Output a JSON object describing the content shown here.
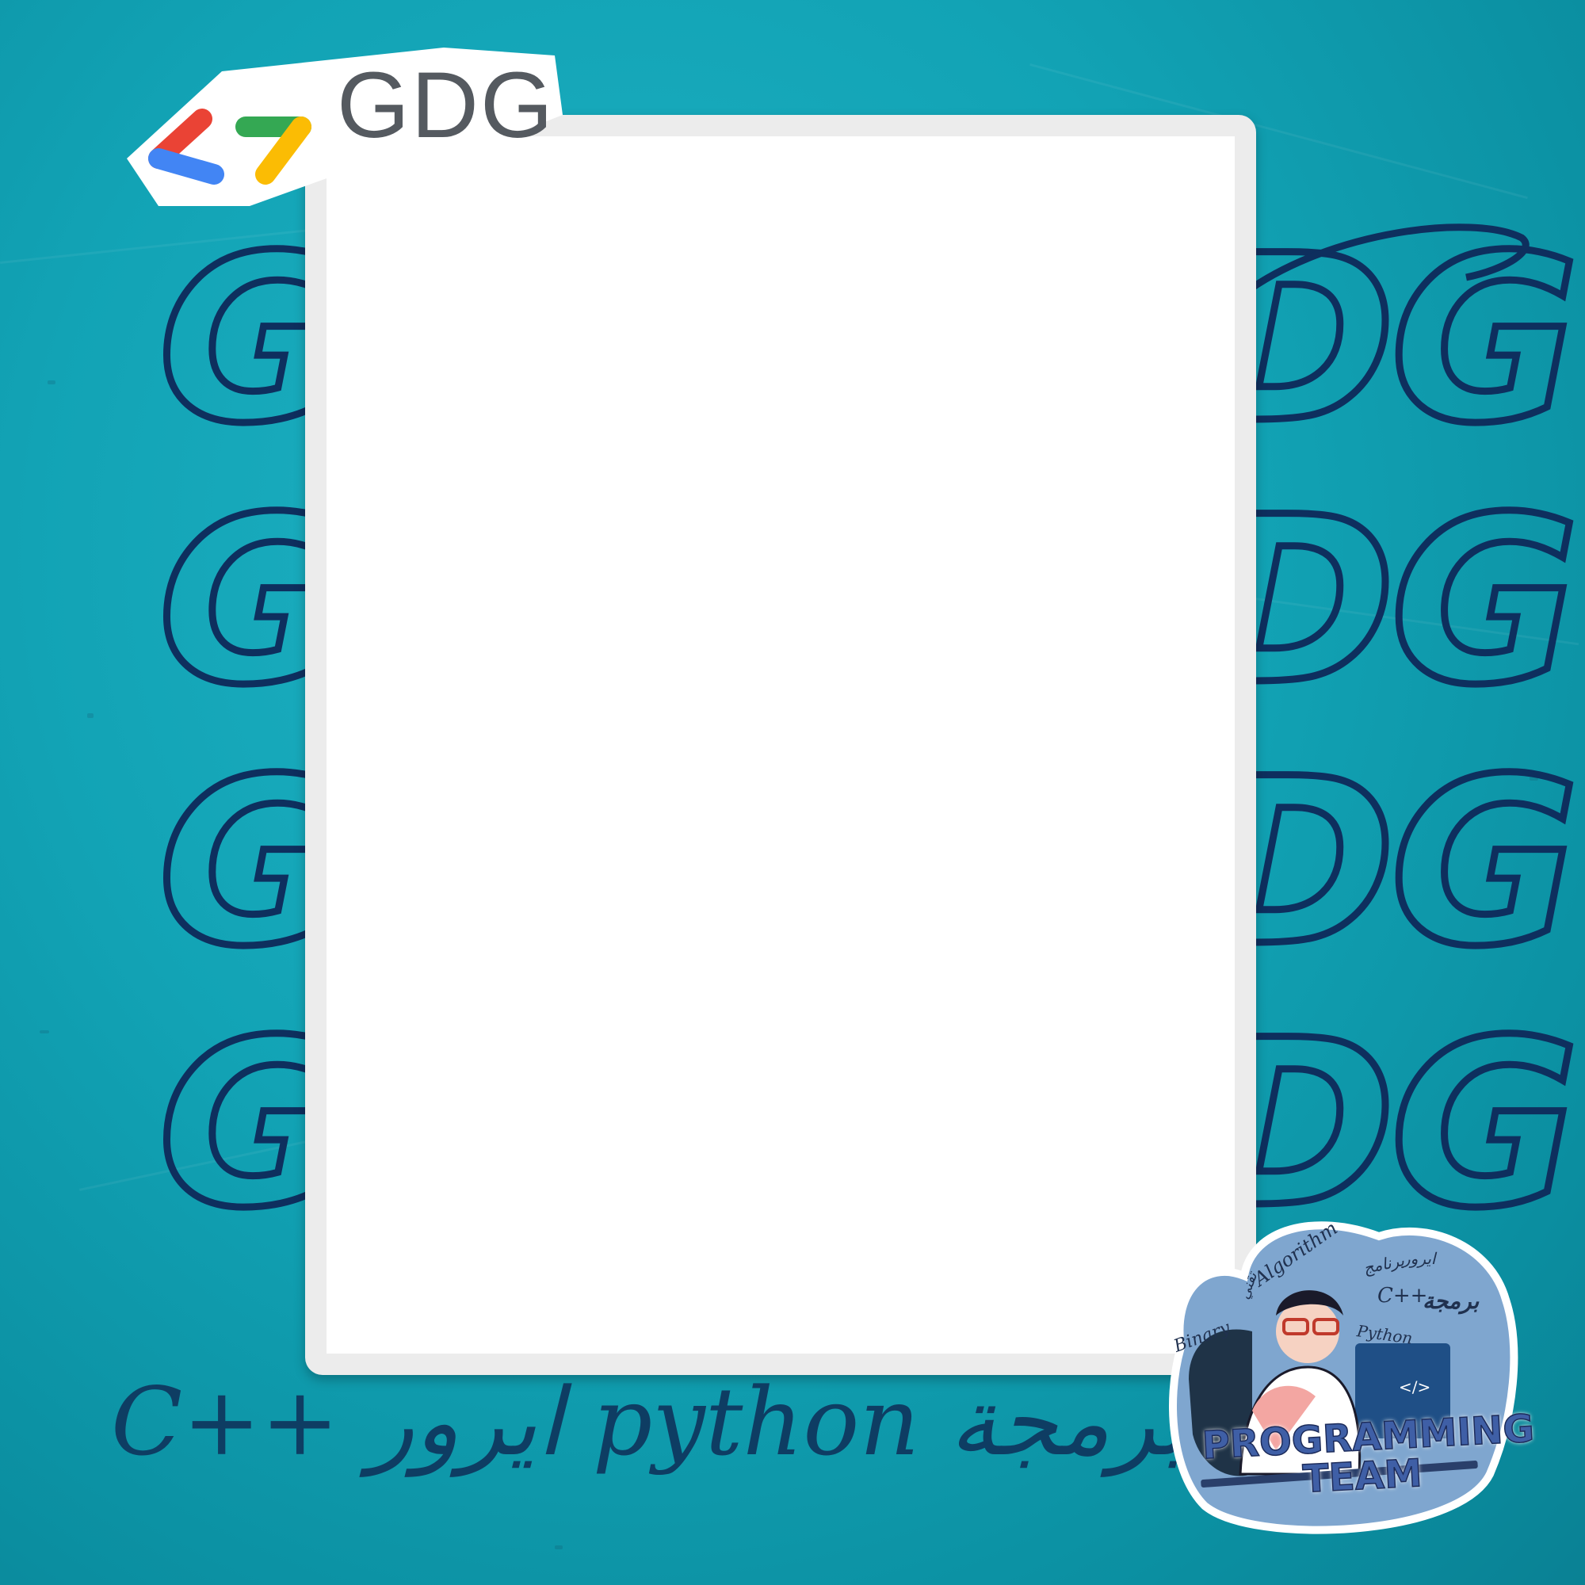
{
  "logo": {
    "wordmark": "GDG"
  },
  "background": {
    "repeated_text": [
      "G",
      "DG"
    ]
  },
  "bottom_text": "C++ ايرور python برمجة",
  "badge": {
    "title_line1": "PROGRAMMING",
    "title_line2": "TEAM",
    "doodle_words": [
      "Algorithm",
      "Binary",
      "Python",
      "C++",
      "برنامج",
      "ايرور",
      "برمجة",
      "تقني"
    ],
    "screen_code": "</>"
  },
  "colors": {
    "background": "#12a3b5",
    "outline_text": "#0e2f5e",
    "frame": "#ececec",
    "logo_red": "#ea4335",
    "logo_green": "#34a853",
    "logo_yellow": "#fbbc04",
    "logo_blue": "#4285f4"
  }
}
